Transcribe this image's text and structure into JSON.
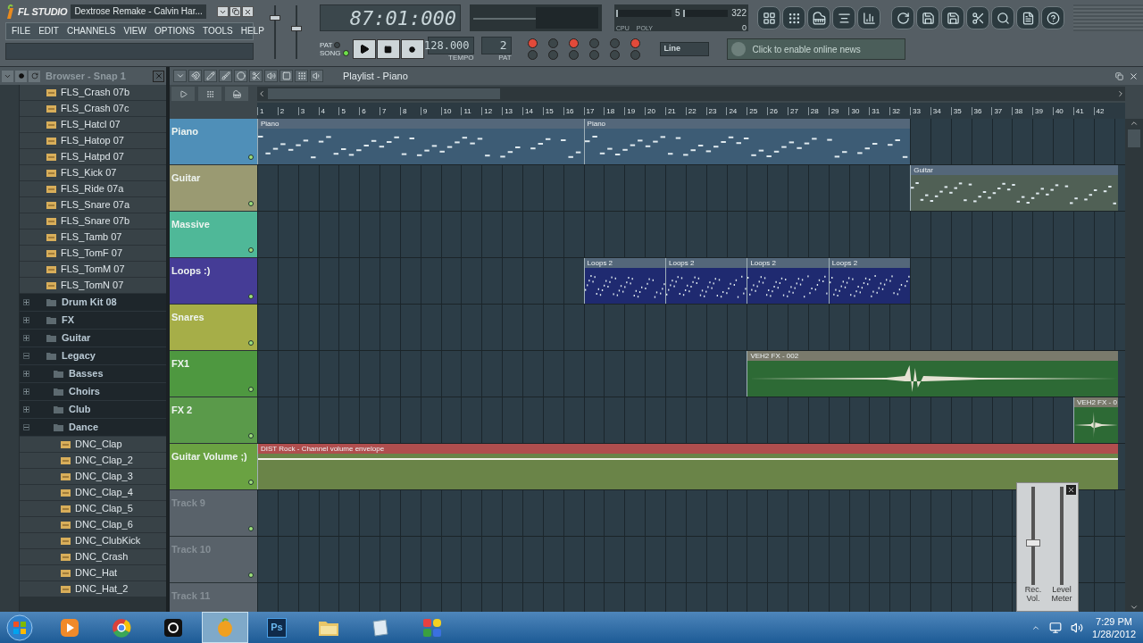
{
  "app": {
    "logo": "FL STUDIO",
    "title": "Dextrose Remake - Calvin Har..."
  },
  "menu": [
    "FILE",
    "EDIT",
    "CHANNELS",
    "VIEW",
    "OPTIONS",
    "TOOLS",
    "HELP"
  ],
  "faders": [
    {
      "level": 0.8
    },
    {
      "level": 0.58
    }
  ],
  "time": "87:01:000",
  "modes": [
    {
      "label": "PAT",
      "selected": false
    },
    {
      "label": "SONG",
      "selected": true
    }
  ],
  "tempo": {
    "value": "128.000",
    "label": "TEMPO"
  },
  "pattern": {
    "value": "2",
    "label": "PAT"
  },
  "cpu": {
    "value": "5",
    "level": 0.04
  },
  "poly": {
    "value": "322",
    "level": 0.05
  },
  "cpu_labels": [
    "CPU",
    "POLY"
  ],
  "cpu_extra": "0",
  "toggles": [
    {
      "on": true
    },
    {
      "on": false
    },
    {
      "on": true
    },
    {
      "on": false
    },
    {
      "on": false
    },
    {
      "on": true
    },
    {
      "on": false
    },
    {
      "on": false
    },
    {
      "on": false
    },
    {
      "on": false
    },
    {
      "on": false
    },
    {
      "on": false
    }
  ],
  "input": {
    "value": "Line"
  },
  "news": "Click to enable online news",
  "browser": {
    "title": "Browser - Snap 1",
    "items": [
      {
        "kind": "file",
        "name": "FLS_Crash 07b"
      },
      {
        "kind": "file",
        "name": "FLS_Crash 07c"
      },
      {
        "kind": "file",
        "name": "FLS_Hatcl 07"
      },
      {
        "kind": "file",
        "name": "FLS_Hatop 07"
      },
      {
        "kind": "file",
        "name": "FLS_Hatpd 07"
      },
      {
        "kind": "file",
        "name": "FLS_Kick 07"
      },
      {
        "kind": "file",
        "name": "FLS_Ride 07a"
      },
      {
        "kind": "file",
        "name": "FLS_Snare 07a"
      },
      {
        "kind": "file",
        "name": "FLS_Snare 07b"
      },
      {
        "kind": "file",
        "name": "FLS_Tamb 07"
      },
      {
        "kind": "file",
        "name": "FLS_TomF 07"
      },
      {
        "kind": "file",
        "name": "FLS_TomM 07"
      },
      {
        "kind": "file",
        "name": "FLS_TomN 07"
      },
      {
        "kind": "folder",
        "name": "Drum Kit 08",
        "expanded": false
      },
      {
        "kind": "folder",
        "name": "FX",
        "expanded": false
      },
      {
        "kind": "folder",
        "name": "Guitar",
        "expanded": false
      },
      {
        "kind": "folder",
        "name": "Legacy",
        "expanded": true,
        "children": [
          {
            "kind": "folder",
            "name": "Basses",
            "expanded": false
          },
          {
            "kind": "folder",
            "name": "Choirs",
            "expanded": false
          },
          {
            "kind": "folder",
            "name": "Club",
            "expanded": false
          },
          {
            "kind": "folder",
            "name": "Dance",
            "expanded": true,
            "children": [
              {
                "kind": "file",
                "name": "DNC_Clap"
              },
              {
                "kind": "file",
                "name": "DNC_Clap_2"
              },
              {
                "kind": "file",
                "name": "DNC_Clap_3"
              },
              {
                "kind": "file",
                "name": "DNC_Clap_4"
              },
              {
                "kind": "file",
                "name": "DNC_Clap_5"
              },
              {
                "kind": "file",
                "name": "DNC_Clap_6"
              },
              {
                "kind": "file",
                "name": "DNC_ClubKick"
              },
              {
                "kind": "file",
                "name": "DNC_Crash"
              },
              {
                "kind": "file",
                "name": "DNC_Hat"
              },
              {
                "kind": "file",
                "name": "DNC_Hat_2"
              }
            ]
          }
        ]
      }
    ]
  },
  "playlist": {
    "title": "Playlist - Piano",
    "ruler": [
      "1",
      "2",
      "3",
      "4",
      "5",
      "6",
      "7",
      "8",
      "9",
      "10",
      "11",
      "12",
      "13",
      "14",
      "15",
      "16",
      "17",
      "18",
      "19",
      "20",
      "21",
      "22",
      "23",
      "24",
      "25",
      "26",
      "27",
      "28",
      "29",
      "30",
      "31",
      "32",
      "33",
      "34",
      "35",
      "36",
      "37",
      "38",
      "39",
      "40",
      "41",
      "42"
    ],
    "tracks": [
      {
        "name": "Piano",
        "color": "#4f8fb8",
        "empty": false,
        "clips": [
          {
            "label": "Piano",
            "kind": "pattern"
          },
          {
            "label": "Piano",
            "kind": "pattern"
          }
        ]
      },
      {
        "name": "Guitar",
        "color": "#9a9a72",
        "empty": false,
        "clips": [
          {
            "label": "Guitar",
            "kind": "pattern"
          }
        ]
      },
      {
        "name": "Massive",
        "color": "#4fb898",
        "empty": false
      },
      {
        "name": "Loops :)",
        "color": "#453c96",
        "empty": false,
        "clips": [
          {
            "label": "Loops 2",
            "kind": "pattern"
          },
          {
            "label": "Loops 2",
            "kind": "pattern"
          },
          {
            "label": "Loops 2",
            "kind": "pattern"
          },
          {
            "label": "Loops 2",
            "kind": "pattern"
          }
        ]
      },
      {
        "name": "Snares",
        "color": "#a6ae48",
        "empty": false
      },
      {
        "name": "FX1",
        "color": "#4e9840",
        "empty": false,
        "clips": [
          {
            "label": "VEH2 FX - 002",
            "kind": "audio"
          }
        ]
      },
      {
        "name": "FX 2",
        "color": "#5a9a4a",
        "empty": false,
        "clips": [
          {
            "label": "VEH2 FX - 0",
            "kind": "audio"
          }
        ]
      },
      {
        "name": "Guitar Volume ;)",
        "color": "#6aa242",
        "empty": false,
        "clips": [
          {
            "label": "DIST Rock - Channel volume envelope",
            "kind": "automation"
          }
        ]
      },
      {
        "name": "Track 9",
        "color": "#59626a",
        "empty": true
      },
      {
        "name": "Track 10",
        "color": "#59626a",
        "empty": true
      },
      {
        "name": "Track 11",
        "color": "#59626a",
        "empty": true
      }
    ]
  },
  "recorder": {
    "rec_vol": {
      "label": "Rec. Vol.",
      "level": 0.42
    },
    "meter": {
      "label": "Level Meter"
    }
  },
  "taskbar": {
    "apps": [
      {
        "kind": "media",
        "selected": false
      },
      {
        "kind": "chrome",
        "selected": false
      },
      {
        "kind": "live",
        "selected": false
      },
      {
        "kind": "fl",
        "selected": true
      },
      {
        "kind": "ps",
        "selected": false,
        "text": "Ps"
      },
      {
        "kind": "explorer",
        "selected": false
      },
      {
        "kind": "notepad",
        "selected": false
      },
      {
        "kind": "blocks",
        "selected": false
      }
    ],
    "time": "7:29 PM",
    "date": "1/28/2012"
  }
}
